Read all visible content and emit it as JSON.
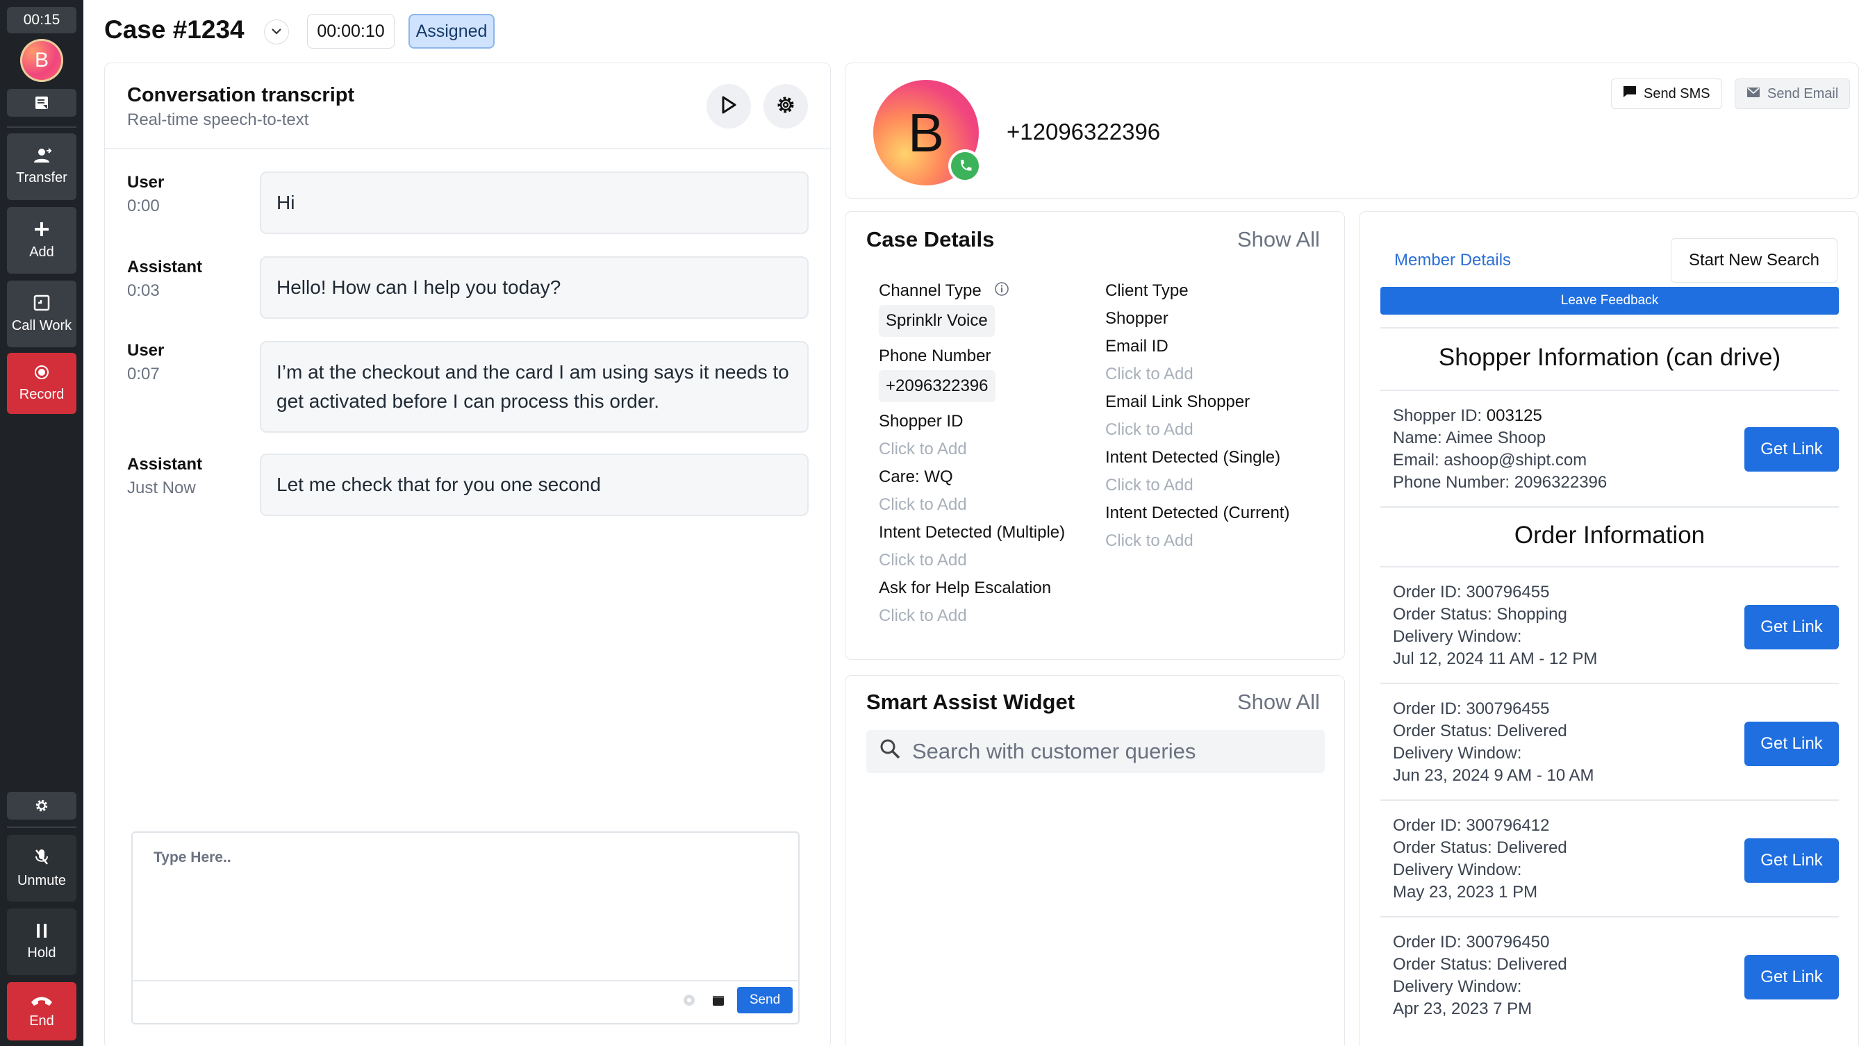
{
  "rail": {
    "timer": "00:15",
    "avatar_letter": "B",
    "transfer_label": "Transfer",
    "add_label": "Add",
    "call_work_label": "Call Work",
    "record_label": "Record",
    "unmute_label": "Unmute",
    "hold_label": "Hold",
    "end_label": "End"
  },
  "header": {
    "title": "Case #1234",
    "elapsed": "00:00:10",
    "status": "Assigned"
  },
  "conversation": {
    "title": "Conversation transcript",
    "subtitle": "Real-time speech-to-text",
    "messages": [
      {
        "role": "User",
        "time": "0:00",
        "text": "Hi"
      },
      {
        "role": "Assistant",
        "time": "0:03",
        "text": "Hello! How can I help you today?"
      },
      {
        "role": "User",
        "time": "0:07",
        "text": "I’m at the checkout and the card I am using says it needs to get activated before I can process this order."
      },
      {
        "role": "Assistant",
        "time": "Just Now",
        "text": "Let me check that for you one second"
      }
    ],
    "composer_placeholder": "Type Here..",
    "send_label": "Send"
  },
  "profile": {
    "avatar_letter": "B",
    "phone": "+12096322396",
    "send_sms_label": "Send SMS",
    "send_email_label": "Send Email"
  },
  "case_details": {
    "title": "Case Details",
    "show_all": "Show All",
    "left": {
      "channel_type_label": "Channel Type",
      "channel_type_value": "Sprinklr Voice",
      "phone_number_label": "Phone Number",
      "phone_number_value": "+2096322396",
      "shopper_id_label": "Shopper ID",
      "shopper_id_value": "Click to Add",
      "care_label": "Care: WQ",
      "care_value": "Click to Add",
      "intent_multiple_label": "Intent Detected (Multiple)",
      "intent_multiple_value": "Click to Add",
      "escalation_label": "Ask for Help Escalation",
      "escalation_value": "Click to Add"
    },
    "right": {
      "client_type_label": "Client Type",
      "client_type_value": "Shopper",
      "email_id_label": "Email ID",
      "email_id_value": "Click to Add",
      "email_link_label": "Email Link Shopper",
      "email_link_value": "Click to Add",
      "intent_single_label": "Intent Detected (Single)",
      "intent_single_value": "Click to Add",
      "intent_current_label": "Intent Detected (Current)",
      "intent_current_value": "Click to Add"
    }
  },
  "smart_assist": {
    "title": "Smart Assist Widget",
    "show_all": "Show All",
    "search_placeholder": "Search with customer queries"
  },
  "member": {
    "tab_label": "Member Details",
    "new_search_label": "Start New Search",
    "feedback_label": "Leave Feedback",
    "shopper_heading": "Shopper Information (can drive)",
    "shopper": {
      "id_label": "Shopper ID: ",
      "id_value": "003125",
      "name": "Name: Aimee Shoop",
      "email": "Email: ashoop@shipt.com",
      "phone": "Phone Number: 2096322396"
    },
    "get_link_label": "Get Link",
    "order_heading": "Order Information",
    "orders": [
      {
        "id": "Order ID: 300796455",
        "status": "Order Status: Shopping",
        "window_label": "Delivery Window:",
        "window": "Jul 12, 2024 11 AM - 12 PM"
      },
      {
        "id": "Order ID: 300796455",
        "status": "Order Status: Delivered",
        "window_label": "Delivery Window:",
        "window": "Jun 23, 2024 9 AM - 10 AM"
      },
      {
        "id": "Order ID: 300796412",
        "status": "Order Status: Delivered",
        "window_label": "Delivery Window:",
        "window": "May 23, 2023 1 PM"
      },
      {
        "id": "Order ID: 300796450",
        "status": "Order Status: Delivered",
        "window_label": "Delivery Window:",
        "window": "Apr 23, 2023 7 PM"
      }
    ]
  },
  "colors": {
    "accent": "#1f6fe0",
    "record": "#d32f3a",
    "rail_bg": "#1f2328",
    "status_badge": "#cfe3ff"
  }
}
